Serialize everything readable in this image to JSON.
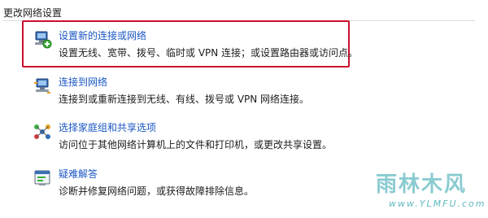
{
  "section": {
    "title": "更改网络设置"
  },
  "tasks": [
    {
      "icon": "new-connection-icon",
      "link": "设置新的连接或网络",
      "desc": "设置无线、宽带、拨号、临时或 VPN 连接；或设置路由器或访问点。"
    },
    {
      "icon": "connect-network-icon",
      "link": "连接到网络",
      "desc": "连接到或重新连接到无线、有线、拨号或 VPN 网络连接。"
    },
    {
      "icon": "homegroup-icon",
      "link": "选择家庭组和共享选项",
      "desc": "访问位于其他网络计算机上的文件和打印机，或更改共享设置。"
    },
    {
      "icon": "troubleshoot-icon",
      "link": "疑难解答",
      "desc": "诊断并修复网络问题，或获得故障排除信息。"
    }
  ],
  "highlight_color": "#c8102e",
  "link_color": "#1a56c4",
  "watermark": {
    "logo": "雨林木风",
    "url": "www.YLMFU.com"
  }
}
